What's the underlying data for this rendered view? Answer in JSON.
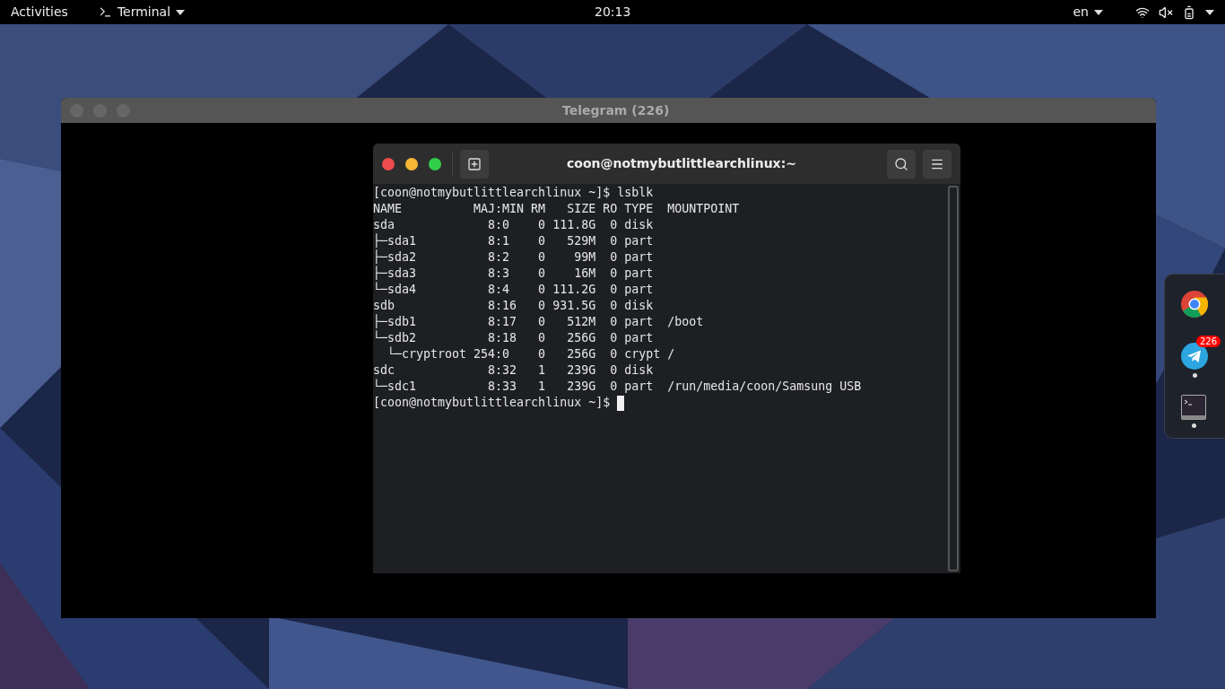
{
  "top_bar": {
    "activities": "Activities",
    "app_menu": "Terminal",
    "clock": "20:13",
    "input_source": "en"
  },
  "background_window": {
    "title": "Telegram (226)"
  },
  "terminal": {
    "title": "coon@notmybutlittlearchlinux:~",
    "lines": [
      "[coon@notmybutlittlearchlinux ~]$ lsblk",
      "NAME          MAJ:MIN RM   SIZE RO TYPE  MOUNTPOINT",
      "sda             8:0    0 111.8G  0 disk  ",
      "├─sda1          8:1    0   529M  0 part  ",
      "├─sda2          8:2    0    99M  0 part  ",
      "├─sda3          8:3    0    16M  0 part  ",
      "└─sda4          8:4    0 111.2G  0 part  ",
      "sdb             8:16   0 931.5G  0 disk  ",
      "├─sdb1          8:17   0   512M  0 part  /boot",
      "└─sdb2          8:18   0   256G  0 part  ",
      "  └─cryptroot 254:0    0   256G  0 crypt /",
      "sdc             8:32   1   239G  0 disk  ",
      "└─sdc1          8:33   1   239G  0 part  /run/media/coon/Samsung USB"
    ],
    "prompt": "[coon@notmybutlittlearchlinux ~]$ "
  },
  "dock": {
    "apps": [
      {
        "kind": "chrome",
        "running": false
      },
      {
        "kind": "telegram",
        "running": true,
        "badge": "226"
      },
      {
        "kind": "terminal",
        "running": true
      }
    ]
  }
}
